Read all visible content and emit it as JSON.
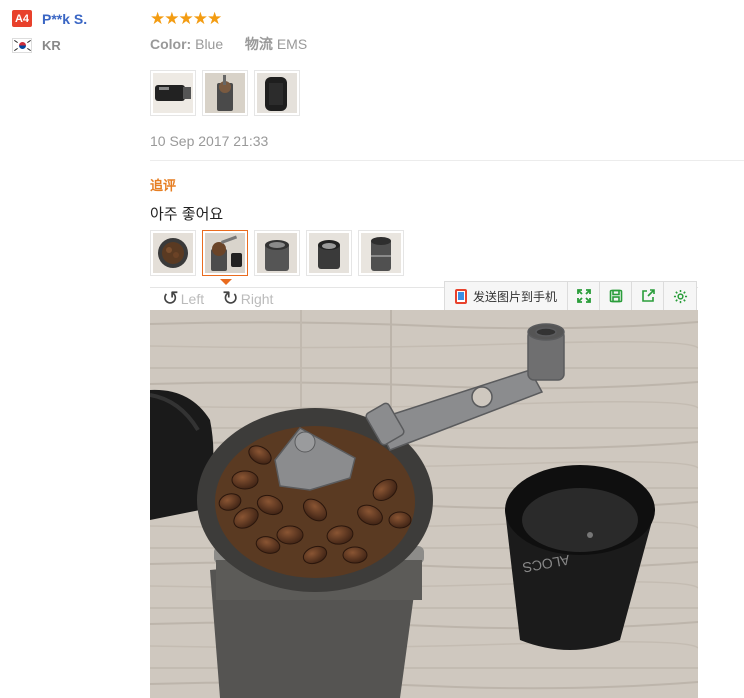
{
  "user": {
    "level": "A4",
    "name": "P**k S.",
    "country": "KR",
    "flag": "kr-flag"
  },
  "review": {
    "rating": 5,
    "stars": "★★★★★",
    "attributes": [
      {
        "key": "Color:",
        "value": "Blue"
      },
      {
        "key": "物流",
        "value": "EMS"
      }
    ],
    "date": "10 Sep 2017 21:33",
    "photos": [
      "grinder-side",
      "grinder-top",
      "grinder-case"
    ]
  },
  "followup": {
    "label": "追评",
    "text": "아주 좋어요",
    "photos": [
      "beans-close",
      "grinder-open",
      "grinder-inside",
      "cup-inside",
      "grinder-body"
    ],
    "selected_index": 1
  },
  "viewer": {
    "rotate_left": "Left",
    "rotate_right": "Right",
    "send_to_phone": "发送图片到手机",
    "tools": [
      "fullscreen-icon",
      "save-icon",
      "share-icon",
      "settings-icon"
    ]
  },
  "colors": {
    "accent": "#e96b1e",
    "star": "#f39c12",
    "link": "#3a66c4",
    "badge": "#e8412c",
    "tool": "#2a9d3a"
  }
}
